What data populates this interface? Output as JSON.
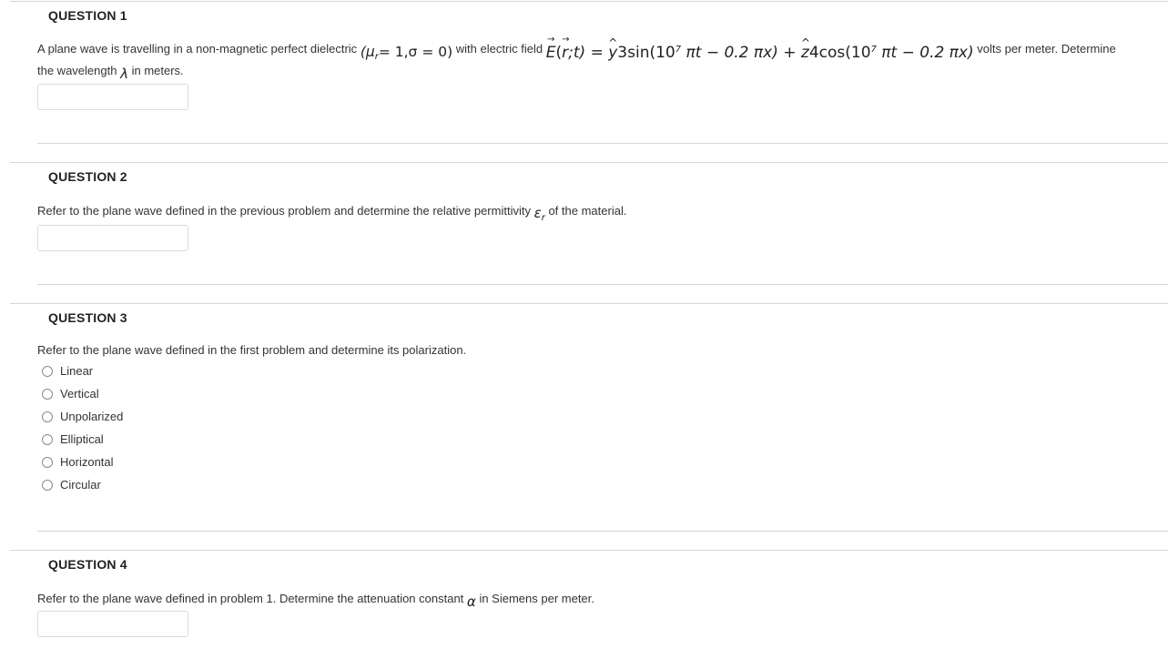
{
  "q1": {
    "title": "QUESTION 1",
    "text_a": "A plane wave is travelling in a non-magnetic perfect dielectric",
    "params": "(μ",
    "params_sub": "r",
    "params_rest": "= 1,σ = 0)",
    "text_b": "with electric field",
    "field_E": "E",
    "field_args_open": "(",
    "field_r": "r",
    "field_args_close": ";t) = ",
    "y_hat": "y",
    "term1": "3sin(10",
    "exp1": "7",
    "term1_rest": " πt − 0.2 πx) + ",
    "z_hat": "z",
    "term2": "4cos(10",
    "exp2": "7",
    "term2_rest": " πt − 0.2 πx)",
    "text_c": "volts per meter.  Determine",
    "line2_a": "the wavelength",
    "lambda": "λ",
    "line2_b": "in meters."
  },
  "q2": {
    "title": "QUESTION 2",
    "text_a": "Refer to the plane wave defined in the previous problem and determine the relative permittivity",
    "eps": "ε",
    "eps_sub": "r",
    "text_b": "of the material."
  },
  "q3": {
    "title": "QUESTION 3",
    "text": "Refer to the plane wave defined in the first problem and determine its polarization.",
    "options": [
      "Linear",
      "Vertical",
      "Unpolarized",
      "Elliptical",
      "Horizontal",
      "Circular"
    ]
  },
  "q4": {
    "title": "QUESTION 4",
    "text_a": "Refer to the plane wave defined in problem 1.  Determine the attenuation constant",
    "alpha": "α",
    "text_b": "in Siemens per meter."
  }
}
